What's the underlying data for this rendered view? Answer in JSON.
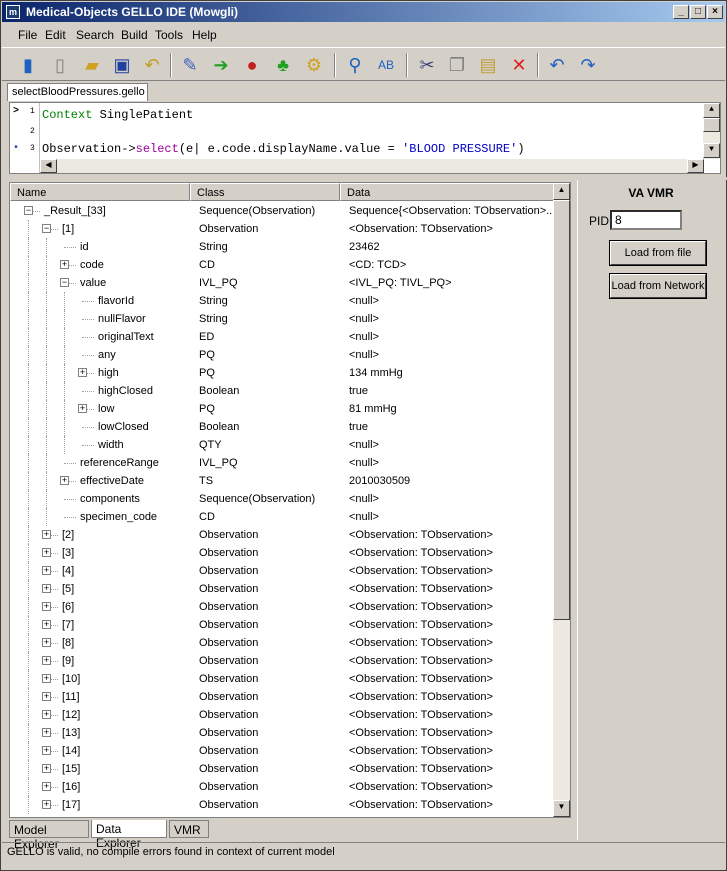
{
  "window": {
    "title": "Medical-Objects GELLO IDE (Mowgli)",
    "controls": [
      "_",
      "□",
      "×"
    ]
  },
  "menu": [
    "File",
    "Edit",
    "Search",
    "Build",
    "Tools",
    "Help"
  ],
  "toolbar": {
    "icons": [
      "exit-icon",
      "new-file-icon",
      "open-folder-icon",
      "save-icon",
      "undo-file-icon",
      "magic-wand-icon",
      "go-arrow-icon",
      "record-icon",
      "tree-icon",
      "gears-icon",
      "find-icon",
      "replace-icon",
      "cut-icon",
      "copy-icon",
      "paste-icon",
      "delete-icon",
      "undo-icon",
      "redo-icon"
    ]
  },
  "file_tab": "selectBloodPressures.gello",
  "editor": {
    "line1": {
      "marker": ">",
      "num": "1",
      "kw": "Context",
      "rest": " SinglePatient"
    },
    "line2": {
      "num": "2"
    },
    "line3": {
      "marker": "•",
      "num": "3",
      "a": "Observation->",
      "fn": "select",
      "b": "(e| e.code.displayName.value = ",
      "str": "'BLOOD PRESSURE'",
      "c": ")"
    }
  },
  "columns": {
    "name": "Name",
    "class": "Class",
    "data": "Data"
  },
  "rows": [
    {
      "name": "_Result_[33]",
      "class": "Sequence(Observation)",
      "data": "Sequence{<Observation: TObservation>...",
      "depth": 0,
      "exp": "-"
    },
    {
      "name": "[1]",
      "class": "Observation",
      "data": "<Observation: TObservation>",
      "depth": 1,
      "exp": "-"
    },
    {
      "name": "id",
      "class": "String",
      "data": "23462",
      "depth": 2,
      "exp": ""
    },
    {
      "name": "code",
      "class": "CD",
      "data": "<CD: TCD>",
      "depth": 2,
      "exp": "+"
    },
    {
      "name": "value",
      "class": "IVL_PQ",
      "data": "<IVL_PQ: TIVL_PQ>",
      "depth": 2,
      "exp": "-"
    },
    {
      "name": "flavorId",
      "class": "String",
      "data": "<null>",
      "depth": 3,
      "exp": ""
    },
    {
      "name": "nullFlavor",
      "class": "String",
      "data": "<null>",
      "depth": 3,
      "exp": ""
    },
    {
      "name": "originalText",
      "class": "ED",
      "data": "<null>",
      "depth": 3,
      "exp": ""
    },
    {
      "name": "any",
      "class": "PQ",
      "data": "<null>",
      "depth": 3,
      "exp": ""
    },
    {
      "name": "high",
      "class": "PQ",
      "data": "134 mmHg",
      "depth": 3,
      "exp": "+"
    },
    {
      "name": "highClosed",
      "class": "Boolean",
      "data": "true",
      "depth": 3,
      "exp": ""
    },
    {
      "name": "low",
      "class": "PQ",
      "data": "81 mmHg",
      "depth": 3,
      "exp": "+"
    },
    {
      "name": "lowClosed",
      "class": "Boolean",
      "data": "true",
      "depth": 3,
      "exp": ""
    },
    {
      "name": "width",
      "class": "QTY",
      "data": "<null>",
      "depth": 3,
      "exp": ""
    },
    {
      "name": "referenceRange",
      "class": "IVL_PQ",
      "data": "<null>",
      "depth": 2,
      "exp": ""
    },
    {
      "name": "effectiveDate",
      "class": "TS",
      "data": "2010030509",
      "depth": 2,
      "exp": "+"
    },
    {
      "name": "components",
      "class": "Sequence(Observation)",
      "data": "<null>",
      "depth": 2,
      "exp": ""
    },
    {
      "name": "specimen_code",
      "class": "CD",
      "data": "<null>",
      "depth": 2,
      "exp": ""
    },
    {
      "name": "[2]",
      "class": "Observation",
      "data": "<Observation: TObservation>",
      "depth": 1,
      "exp": "+"
    },
    {
      "name": "[3]",
      "class": "Observation",
      "data": "<Observation: TObservation>",
      "depth": 1,
      "exp": "+"
    },
    {
      "name": "[4]",
      "class": "Observation",
      "data": "<Observation: TObservation>",
      "depth": 1,
      "exp": "+"
    },
    {
      "name": "[5]",
      "class": "Observation",
      "data": "<Observation: TObservation>",
      "depth": 1,
      "exp": "+"
    },
    {
      "name": "[6]",
      "class": "Observation",
      "data": "<Observation: TObservation>",
      "depth": 1,
      "exp": "+"
    },
    {
      "name": "[7]",
      "class": "Observation",
      "data": "<Observation: TObservation>",
      "depth": 1,
      "exp": "+"
    },
    {
      "name": "[8]",
      "class": "Observation",
      "data": "<Observation: TObservation>",
      "depth": 1,
      "exp": "+"
    },
    {
      "name": "[9]",
      "class": "Observation",
      "data": "<Observation: TObservation>",
      "depth": 1,
      "exp": "+"
    },
    {
      "name": "[10]",
      "class": "Observation",
      "data": "<Observation: TObservation>",
      "depth": 1,
      "exp": "+"
    },
    {
      "name": "[11]",
      "class": "Observation",
      "data": "<Observation: TObservation>",
      "depth": 1,
      "exp": "+"
    },
    {
      "name": "[12]",
      "class": "Observation",
      "data": "<Observation: TObservation>",
      "depth": 1,
      "exp": "+"
    },
    {
      "name": "[13]",
      "class": "Observation",
      "data": "<Observation: TObservation>",
      "depth": 1,
      "exp": "+"
    },
    {
      "name": "[14]",
      "class": "Observation",
      "data": "<Observation: TObservation>",
      "depth": 1,
      "exp": "+"
    },
    {
      "name": "[15]",
      "class": "Observation",
      "data": "<Observation: TObservation>",
      "depth": 1,
      "exp": "+"
    },
    {
      "name": "[16]",
      "class": "Observation",
      "data": "<Observation: TObservation>",
      "depth": 1,
      "exp": "+"
    },
    {
      "name": "[17]",
      "class": "Observation",
      "data": "<Observation: TObservation>",
      "depth": 1,
      "exp": "+"
    }
  ],
  "bottom_tabs": [
    "Model Explorer",
    "Data Explorer",
    "VMR"
  ],
  "vmr": {
    "title": "VA VMR",
    "pid_label": "PID",
    "pid_value": "8",
    "load_file": "Load from file",
    "load_network": "Load from Network"
  },
  "status": "GELLO is valid, no compile errors found in context of current model"
}
